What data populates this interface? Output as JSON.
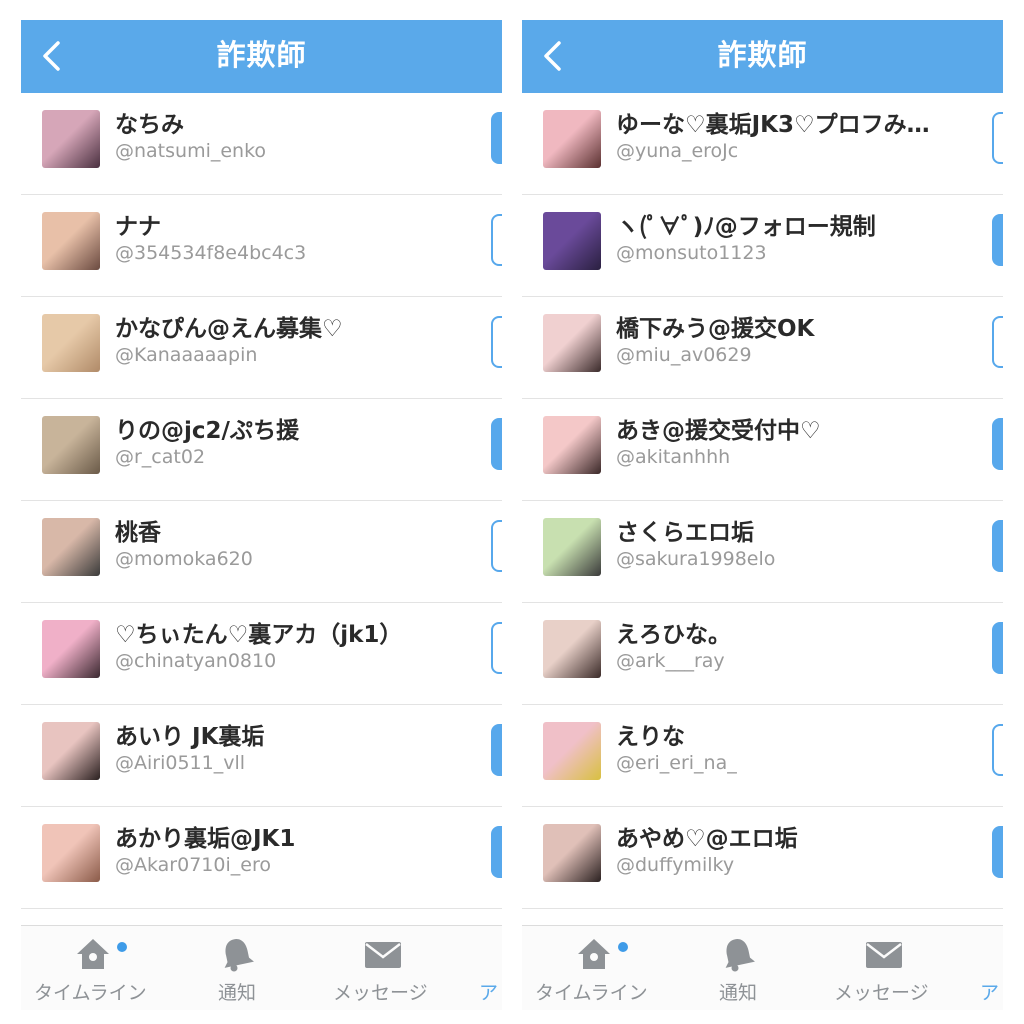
{
  "colors": {
    "accent": "#5aa9ea",
    "follow_button": "#57a8ec",
    "tab_icon": "#8e9296"
  },
  "panels": [
    {
      "navbar": {
        "title": "詐欺師",
        "back_icon": "chevron-left-icon"
      },
      "rows": [
        {
          "name": "なちみ",
          "handle": "@natsumi_enko",
          "following": true,
          "avatar_colors": [
            "#d6a6b8",
            "#4a3040"
          ]
        },
        {
          "name": "ナナ",
          "handle": "@354534f8e4bc4c3",
          "following": false,
          "avatar_colors": [
            "#e8c0a8",
            "#6a4a40"
          ]
        },
        {
          "name": "かなぴん@えん募集♡",
          "handle": "@Kanaaaaapin",
          "following": false,
          "avatar_colors": [
            "#e6c9a8",
            "#b08a68"
          ]
        },
        {
          "name": "りの@jc2/ぷち援",
          "handle": "@r_cat02",
          "following": true,
          "avatar_colors": [
            "#c8b49a",
            "#6a5a48"
          ]
        },
        {
          "name": "桃香",
          "handle": "@momoka620",
          "following": false,
          "avatar_colors": [
            "#d8b8a8",
            "#3a3a3a"
          ]
        },
        {
          "name": "♡ちぃたん♡裏アカ（jk1）",
          "handle": "@chinatyan0810",
          "following": false,
          "avatar_colors": [
            "#f0b0c8",
            "#3a2830"
          ]
        },
        {
          "name": "あいり JK裏垢",
          "handle": "@Airi0511_vll",
          "following": true,
          "avatar_colors": [
            "#e8c4c0",
            "#2a2020"
          ]
        },
        {
          "name": "あかり裏垢@JK1",
          "handle": "@Akar0710i_ero",
          "following": true,
          "avatar_colors": [
            "#f0c4b8",
            "#8a5a48"
          ]
        }
      ],
      "tabs": [
        {
          "label": "タイムライン",
          "icon": "home-icon",
          "badge": true
        },
        {
          "label": "通知",
          "icon": "bell-icon",
          "badge": false
        },
        {
          "label": "メッセージ",
          "icon": "envelope-icon",
          "badge": false
        },
        {
          "label": "ア",
          "icon": "",
          "badge": false
        }
      ]
    },
    {
      "navbar": {
        "title": "詐欺師",
        "back_icon": "chevron-left-icon"
      },
      "rows": [
        {
          "name": "ゆーな♡裏垢JK3♡プロフみ…",
          "handle": "@yuna_eroJc",
          "following": false,
          "avatar_colors": [
            "#f0b8c0",
            "#5a3030"
          ]
        },
        {
          "name": "ヽ(ﾟ∀ﾟ)ﾉ@フォロー規制",
          "handle": "@monsuto1123",
          "following": true,
          "avatar_colors": [
            "#6a4a9a",
            "#2a2040"
          ]
        },
        {
          "name": "橋下みう@援交OK",
          "handle": "@miu_av0629",
          "following": false,
          "avatar_colors": [
            "#f0d0d0",
            "#3a2a2a"
          ]
        },
        {
          "name": "あき@援交受付中♡",
          "handle": "@akitanhhh",
          "following": true,
          "avatar_colors": [
            "#f4c8c8",
            "#3a2828"
          ]
        },
        {
          "name": "さくらエロ垢",
          "handle": "@sakura1998elo",
          "following": true,
          "avatar_colors": [
            "#c8e0b0",
            "#3a3a3a"
          ]
        },
        {
          "name": "えろひな。",
          "handle": "@ark___ray",
          "following": true,
          "avatar_colors": [
            "#e8d0c8",
            "#3a2a28"
          ]
        },
        {
          "name": "えりな",
          "handle": "@eri_eri_na_",
          "following": false,
          "avatar_colors": [
            "#f0c0c8",
            "#d8c040"
          ]
        },
        {
          "name": "あやめ♡@エロ垢",
          "handle": "@duffymilky",
          "following": true,
          "avatar_colors": [
            "#e0c0b8",
            "#2a2020"
          ]
        }
      ],
      "tabs": [
        {
          "label": "タイムライン",
          "icon": "home-icon",
          "badge": true
        },
        {
          "label": "通知",
          "icon": "bell-icon",
          "badge": false
        },
        {
          "label": "メッセージ",
          "icon": "envelope-icon",
          "badge": false
        },
        {
          "label": "ア",
          "icon": "",
          "badge": false
        }
      ]
    }
  ]
}
